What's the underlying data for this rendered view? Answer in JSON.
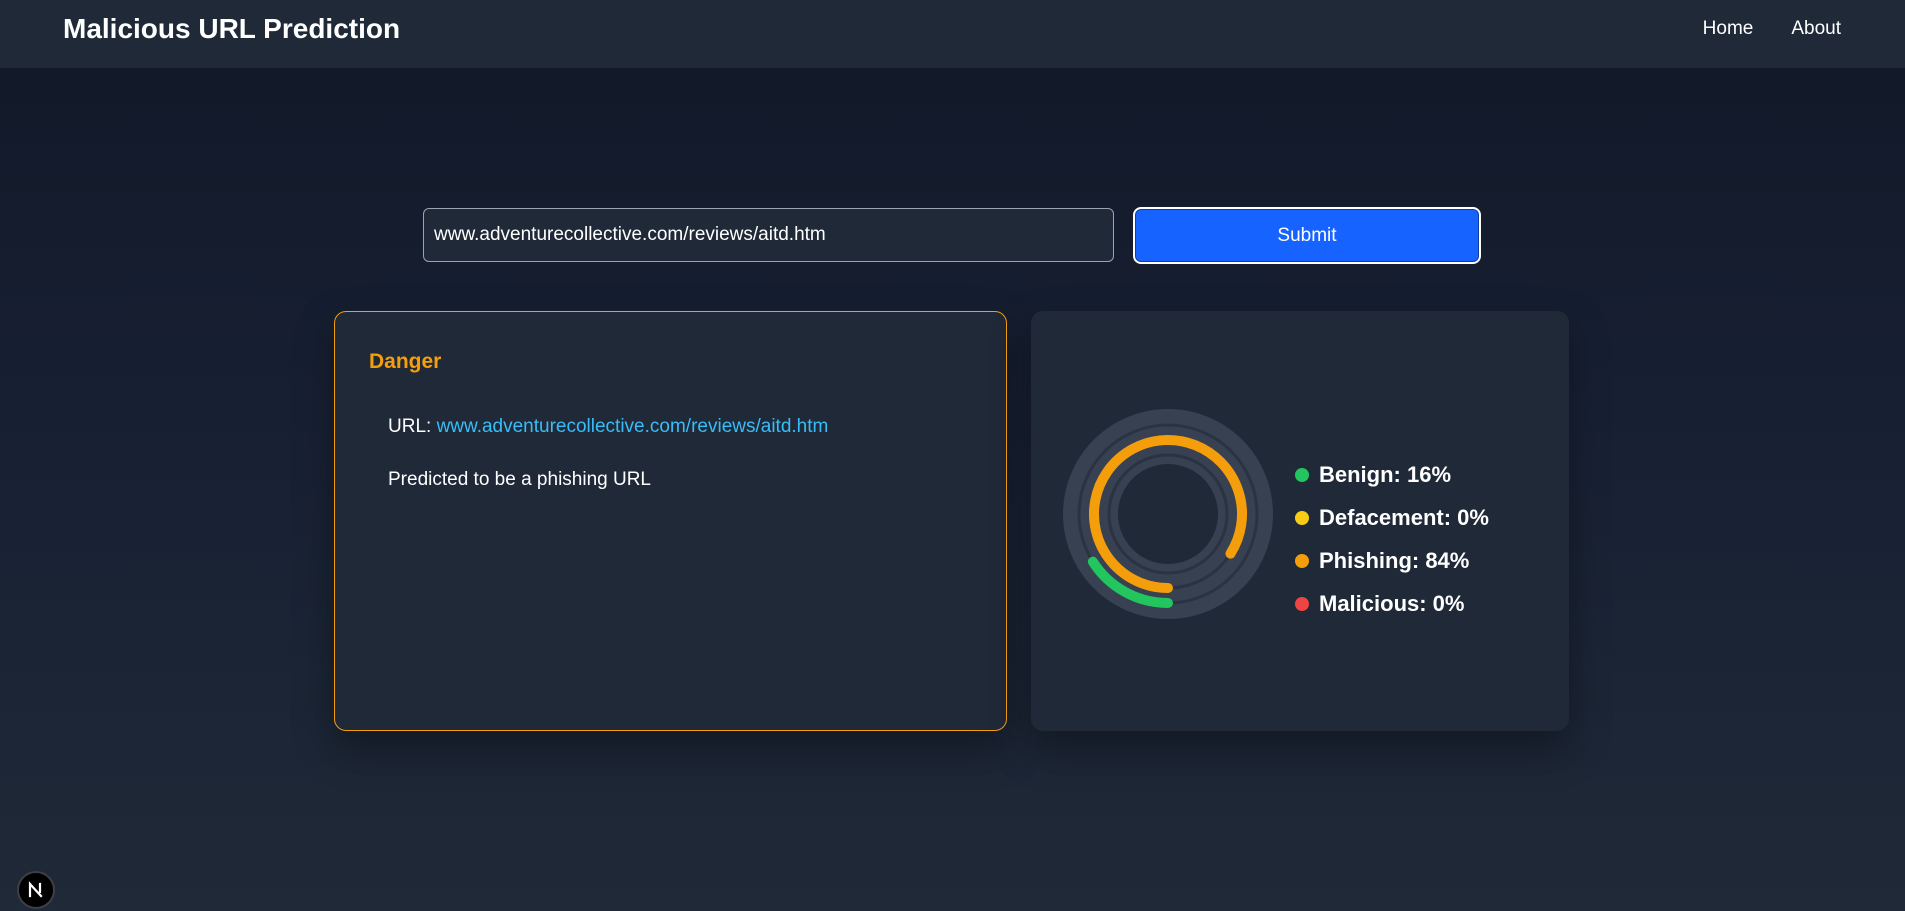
{
  "header": {
    "title": "Malicious URL Prediction",
    "nav": [
      {
        "label": "Home"
      },
      {
        "label": "About"
      }
    ]
  },
  "search": {
    "value": "www.adventurecollective.com/reviews/aitd.htm",
    "submit_label": "Submit"
  },
  "result": {
    "status": "Danger",
    "url_prefix": "URL:",
    "url": "www.adventurecollective.com/reviews/aitd.htm",
    "message": "Predicted to be a phishing URL"
  },
  "chart": {
    "legend": [
      {
        "label": "Benign: 16%",
        "color": "#22c55e",
        "value": 16
      },
      {
        "label": "Defacement: 0%",
        "color": "#facc15",
        "value": 0
      },
      {
        "label": "Phishing: 84%",
        "color": "#f59e0b",
        "value": 84
      },
      {
        "label": "Malicious: 0%",
        "color": "#ef4444",
        "value": 0
      }
    ]
  },
  "colors": {
    "accent": "#1763ff",
    "danger": "#f59e0b",
    "link": "#38bdf8"
  },
  "icons": {
    "badge": "nextjs-logo-icon"
  }
}
